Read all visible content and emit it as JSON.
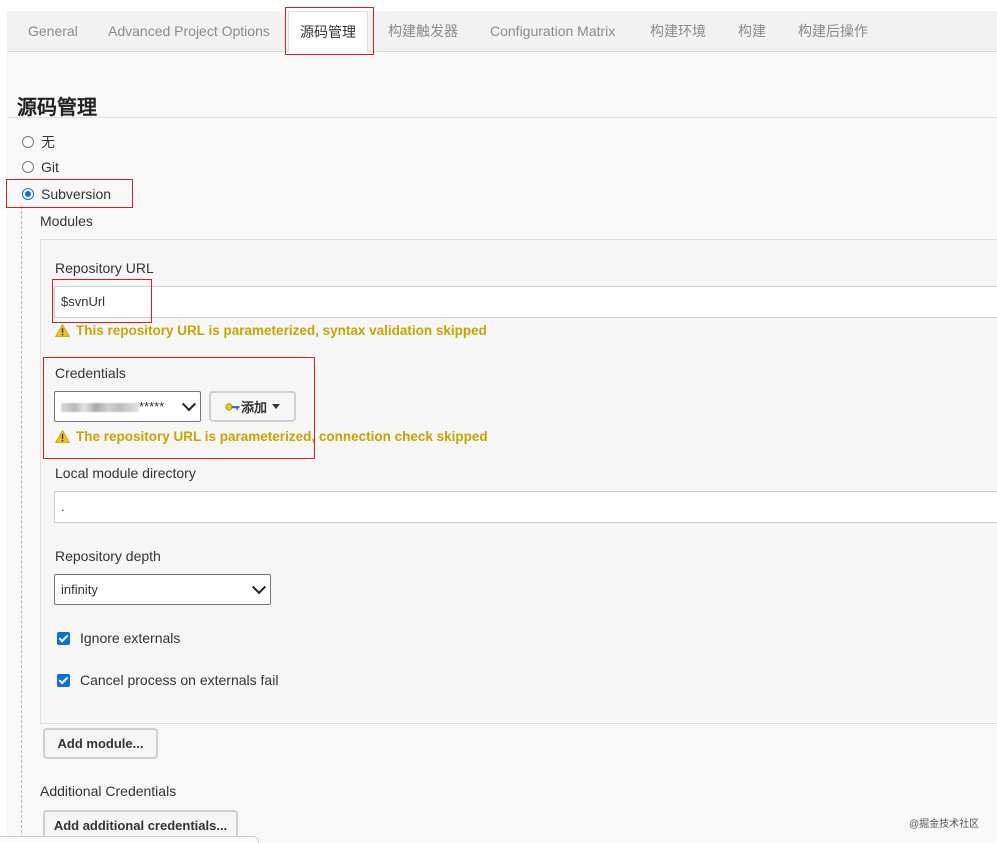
{
  "tabs": [
    {
      "label": "General"
    },
    {
      "label": "Advanced Project Options"
    },
    {
      "label": "源码管理"
    },
    {
      "label": "构建触发器"
    },
    {
      "label": "Configuration Matrix"
    },
    {
      "label": "构建环境"
    },
    {
      "label": "构建"
    },
    {
      "label": "构建后操作"
    }
  ],
  "active_tab": "源码管理",
  "section_title": "源码管理",
  "scm_options": [
    {
      "label": "无",
      "selected": false
    },
    {
      "label": "Git",
      "selected": false
    },
    {
      "label": "Subversion",
      "selected": true
    }
  ],
  "modules_label": "Modules",
  "repository_url": {
    "label": "Repository URL",
    "value": "$svnUrl",
    "warning": "This repository URL is parameterized, syntax validation skipped"
  },
  "credentials": {
    "label": "Credentials",
    "selected_masked": "*****",
    "add_button": "添加",
    "warning": "The repository URL is parameterized, connection check skipped"
  },
  "local_module_directory": {
    "label": "Local module directory",
    "value": "."
  },
  "repository_depth": {
    "label": "Repository depth",
    "value": "infinity"
  },
  "ignore_externals": {
    "label": "Ignore externals",
    "checked": true
  },
  "cancel_process": {
    "label": "Cancel process on externals fail",
    "checked": true
  },
  "add_module_button": "Add module...",
  "additional_credentials": {
    "label": "Additional Credentials",
    "button": "Add additional credentials..."
  },
  "watermark": "@掘金技术社区",
  "colors": {
    "accent": "#0b6fd6",
    "warning": "#c7a500",
    "highlight": "#d61f1f"
  }
}
